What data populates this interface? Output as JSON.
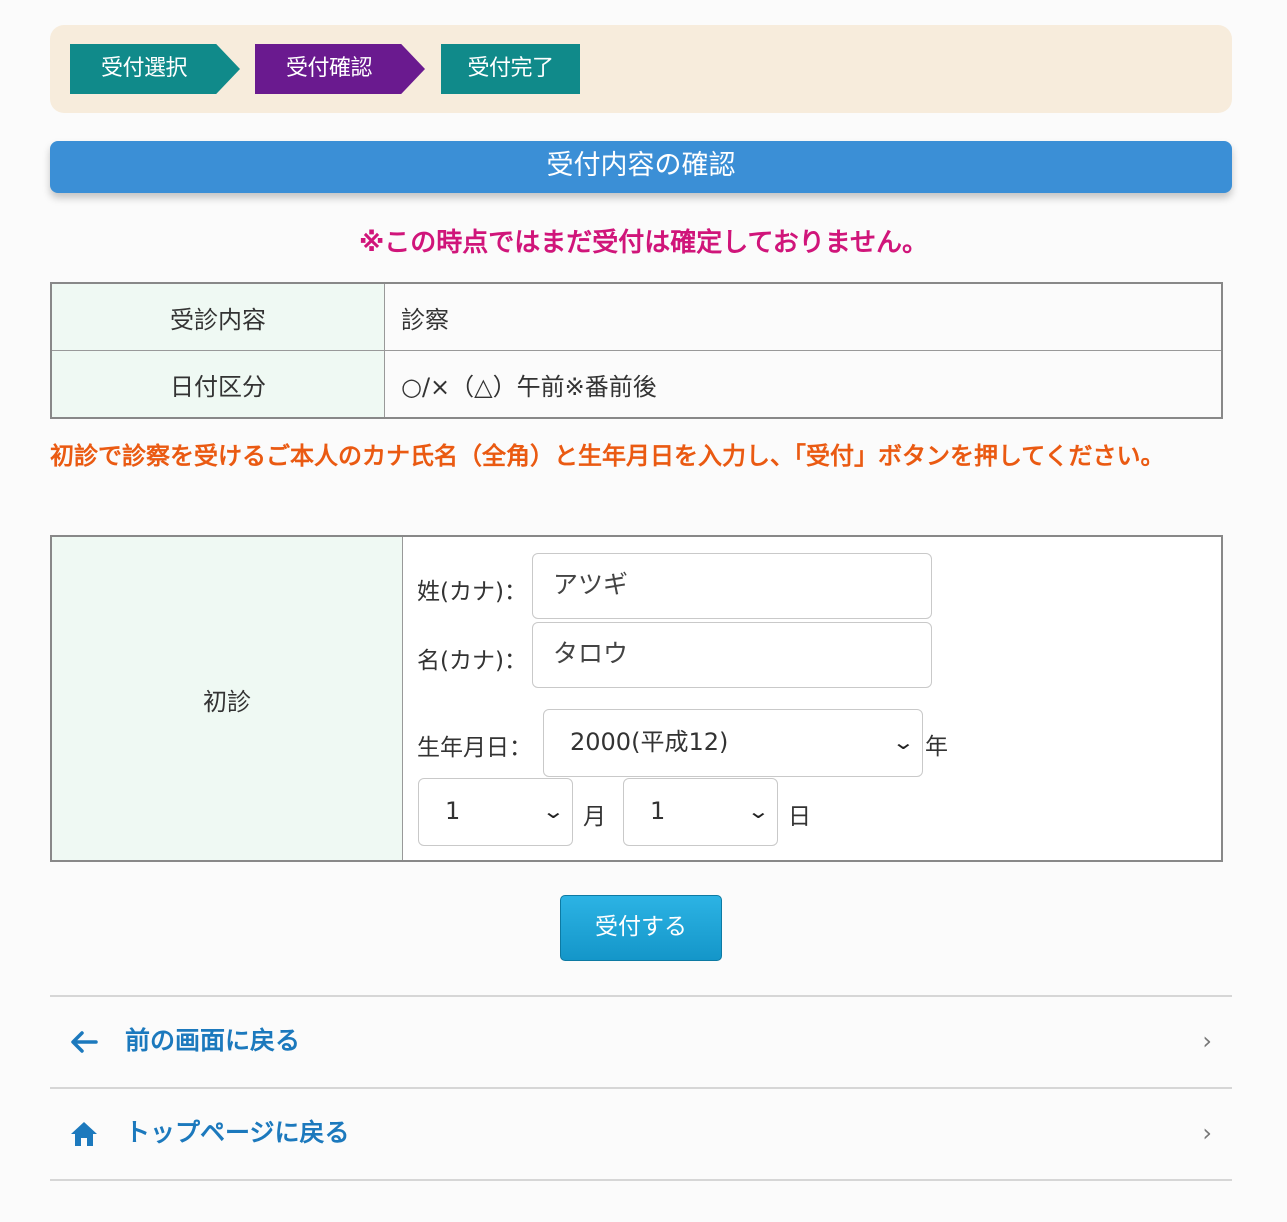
{
  "steps": [
    "受付選択",
    "受付確認",
    "受付完了"
  ],
  "colors": {
    "step_done": "#108a8a",
    "step_current": "#6a1a8f",
    "header": "#3b8fd6",
    "warning": "#d0157a",
    "instruction": "#ea5a12",
    "link": "#1c79bd"
  },
  "section_title": "受付内容の確認",
  "warning": "※この時点ではまだ受付は確定しておりません。",
  "info": [
    {
      "label": "受診内容",
      "value": "診察"
    },
    {
      "label": "日付区分",
      "value": "○/×（△）午前※番前後"
    }
  ],
  "instruction": "初診で診察を受けるご本人のカナ氏名（全角）と生年月日を入力し、「受付」ボタンを押してください。",
  "form": {
    "section_label": "初診",
    "last_name_label": "姓(カナ)：",
    "last_name_value": "アツギ",
    "first_name_label": "名(カナ)：",
    "first_name_value": "タロウ",
    "birth_label": "生年月日：",
    "year_value": "2000(平成12)",
    "year_unit": "年",
    "month_value": "1",
    "month_unit": "月",
    "day_value": "1",
    "day_unit": "日"
  },
  "submit_label": "受付する",
  "nav": {
    "back_label": "前の画面に戻る",
    "top_label": "トップページに戻る",
    "back_icon": "arrow-left-icon",
    "top_icon": "home-icon"
  }
}
